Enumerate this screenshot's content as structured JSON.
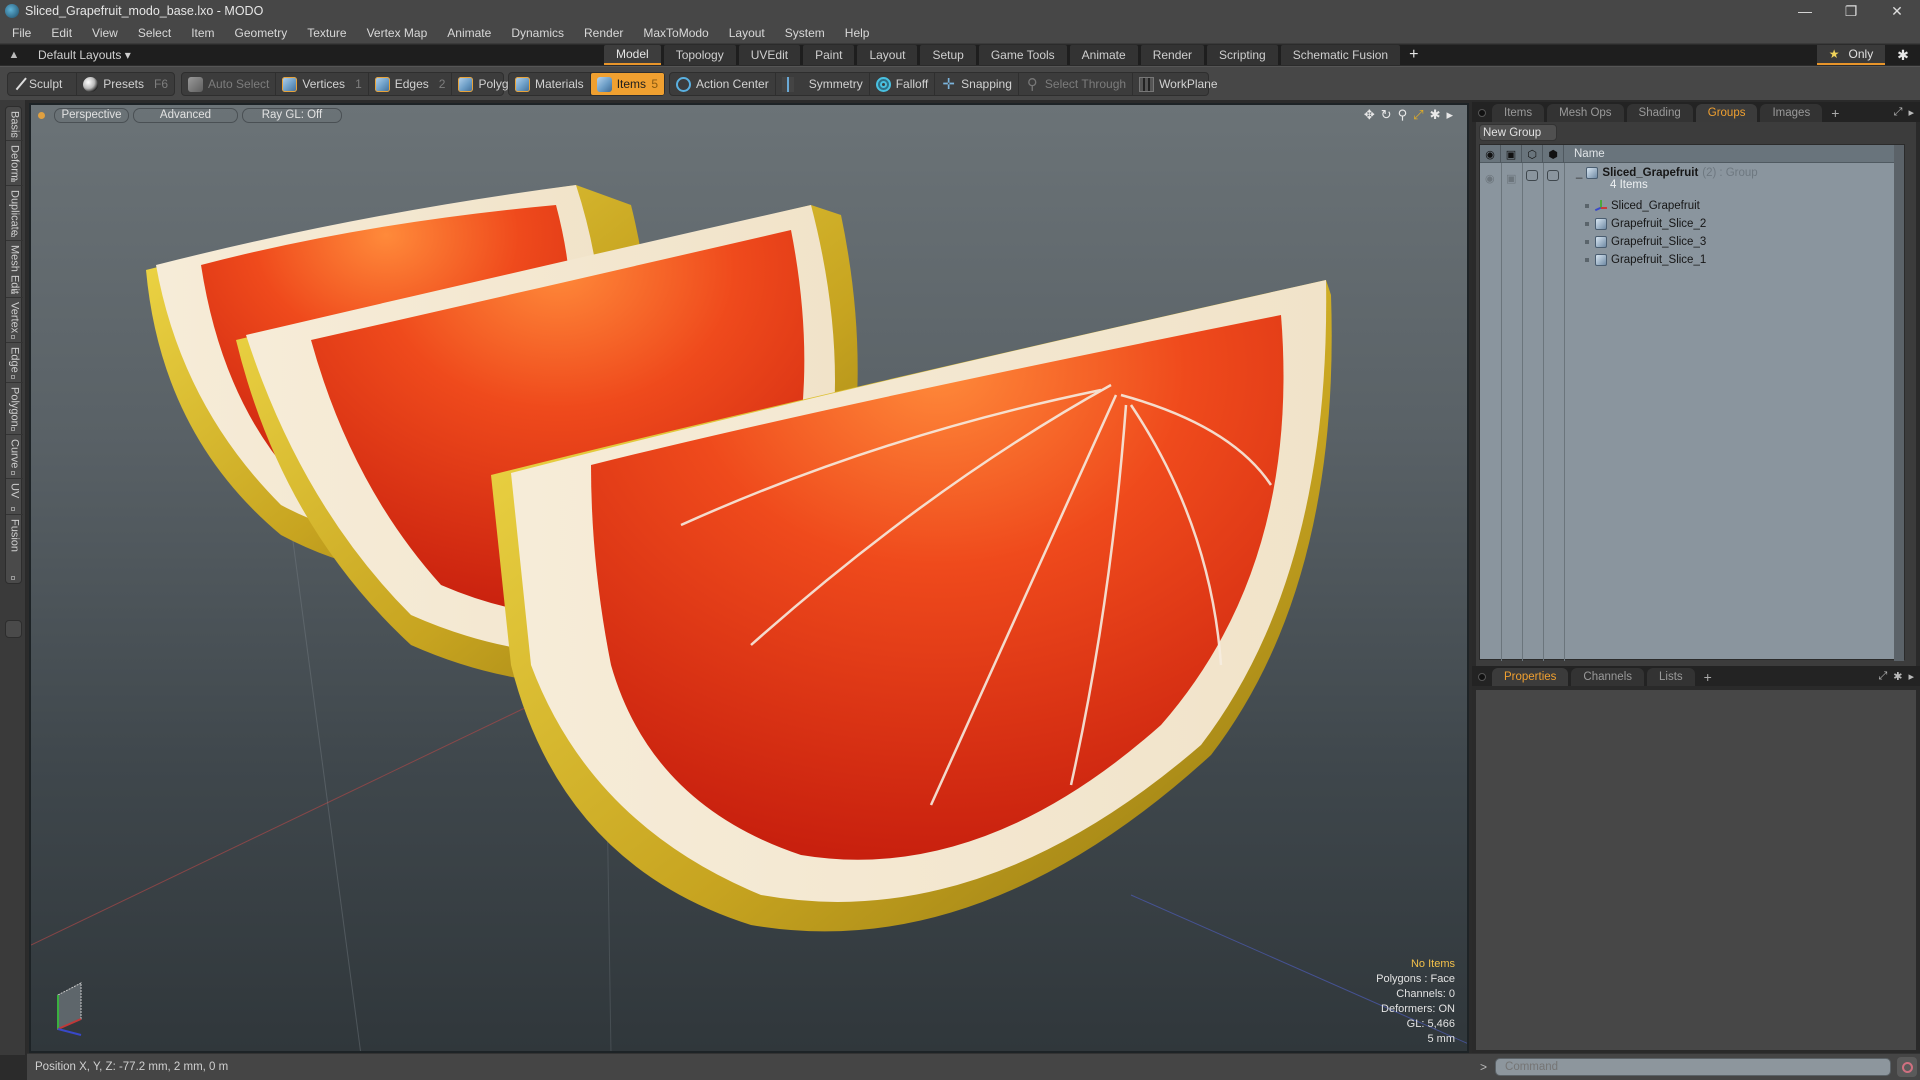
{
  "window": {
    "title": "Sliced_Grapefruit_modo_base.lxo - MODO",
    "controls": {
      "minimize": "—",
      "restore": "❐",
      "close": "✕"
    }
  },
  "menu": [
    "File",
    "Edit",
    "View",
    "Select",
    "Item",
    "Geometry",
    "Texture",
    "Vertex Map",
    "Animate",
    "Dynamics",
    "Render",
    "MaxToModo",
    "Layout",
    "System",
    "Help"
  ],
  "layout_bar": {
    "layouts_label": "Default Layouts ▾",
    "mode_tabs": [
      {
        "label": "Model",
        "active": true
      },
      {
        "label": "Topology",
        "active": false
      },
      {
        "label": "UVEdit",
        "active": false
      },
      {
        "label": "Paint",
        "active": false
      },
      {
        "label": "Layout",
        "active": false
      },
      {
        "label": "Setup",
        "active": false
      },
      {
        "label": "Game Tools",
        "active": false
      },
      {
        "label": "Animate",
        "active": false
      },
      {
        "label": "Render",
        "active": false
      },
      {
        "label": "Scripting",
        "active": false
      },
      {
        "label": "Schematic Fusion",
        "active": false
      }
    ],
    "add_tab": "+",
    "only_label": "Only",
    "only_icon": "★",
    "settings_icon": "✱"
  },
  "toolbar": {
    "sculpt": "Sculpt",
    "presets": "Presets",
    "presets_key": "F6",
    "auto_select": "Auto Select",
    "vertices": "Vertices",
    "vertices_key": "1",
    "edges": "Edges",
    "edges_key": "2",
    "polygons": "Polygons",
    "materials": "Materials",
    "items": "Items",
    "items_key": "5",
    "action_center": "Action Center",
    "symmetry": "Symmetry",
    "falloff": "Falloff",
    "snapping": "Snapping",
    "select_through": "Select Through",
    "workplane": "WorkPlane"
  },
  "left_tabs": [
    "Basic",
    "Deform",
    "Duplicate",
    "Mesh Edit",
    "Vertex",
    "Edge",
    "Polygon",
    "Curve",
    "UV",
    "Fusion"
  ],
  "viewport": {
    "view_mode": "Perspective",
    "shading": "Advanced",
    "raygl": "Ray GL: Off",
    "tool_icons": [
      "move-icon",
      "rotate-icon",
      "zoom-icon",
      "maximize-icon",
      "settings-icon",
      "expand-arrow-icon"
    ],
    "info": {
      "selection": "No Items",
      "polygons": "Polygons : Face",
      "channels": "Channels: 0",
      "deformers": "Deformers: ON",
      "gl": "GL: 5,466",
      "grid": "5 mm"
    },
    "scene_objects": [
      "Grapefruit_Slice_1",
      "Grapefruit_Slice_2",
      "Grapefruit_Slice_3"
    ],
    "colors": {
      "flesh": "#e8381a",
      "pith": "#f3e6d0",
      "rind": "#d8b82a"
    }
  },
  "status": {
    "position": "Position X, Y, Z:   -77.2 mm, 2 mm, 0 m"
  },
  "groups_panel": {
    "tabs": [
      {
        "label": "Items",
        "active": false
      },
      {
        "label": "Mesh Ops",
        "active": false
      },
      {
        "label": "Shading",
        "active": false
      },
      {
        "label": "Groups",
        "active": true
      },
      {
        "label": "Images",
        "active": false
      }
    ],
    "add_tab": "+",
    "new_group": "New Group",
    "column_name": "Name",
    "group": {
      "name": "Sliced_Grapefruit",
      "count": "(2)",
      "type": ": Group",
      "items_label": "4 Items"
    },
    "children": [
      {
        "name": "Sliced_Grapefruit",
        "type": "locator"
      },
      {
        "name": "Grapefruit_Slice_2",
        "type": "mesh"
      },
      {
        "name": "Grapefruit_Slice_3",
        "type": "mesh"
      },
      {
        "name": "Grapefruit_Slice_1",
        "type": "mesh"
      }
    ]
  },
  "properties_panel": {
    "tabs": [
      {
        "label": "Properties",
        "active": true
      },
      {
        "label": "Channels",
        "active": false
      },
      {
        "label": "Lists",
        "active": false
      }
    ],
    "add_tab": "+"
  },
  "command": {
    "prompt": ">",
    "placeholder": "Command"
  },
  "theme": {
    "accent": "#f0a030",
    "panel_bg": "#474747",
    "tree_bg": "#8a959e"
  }
}
